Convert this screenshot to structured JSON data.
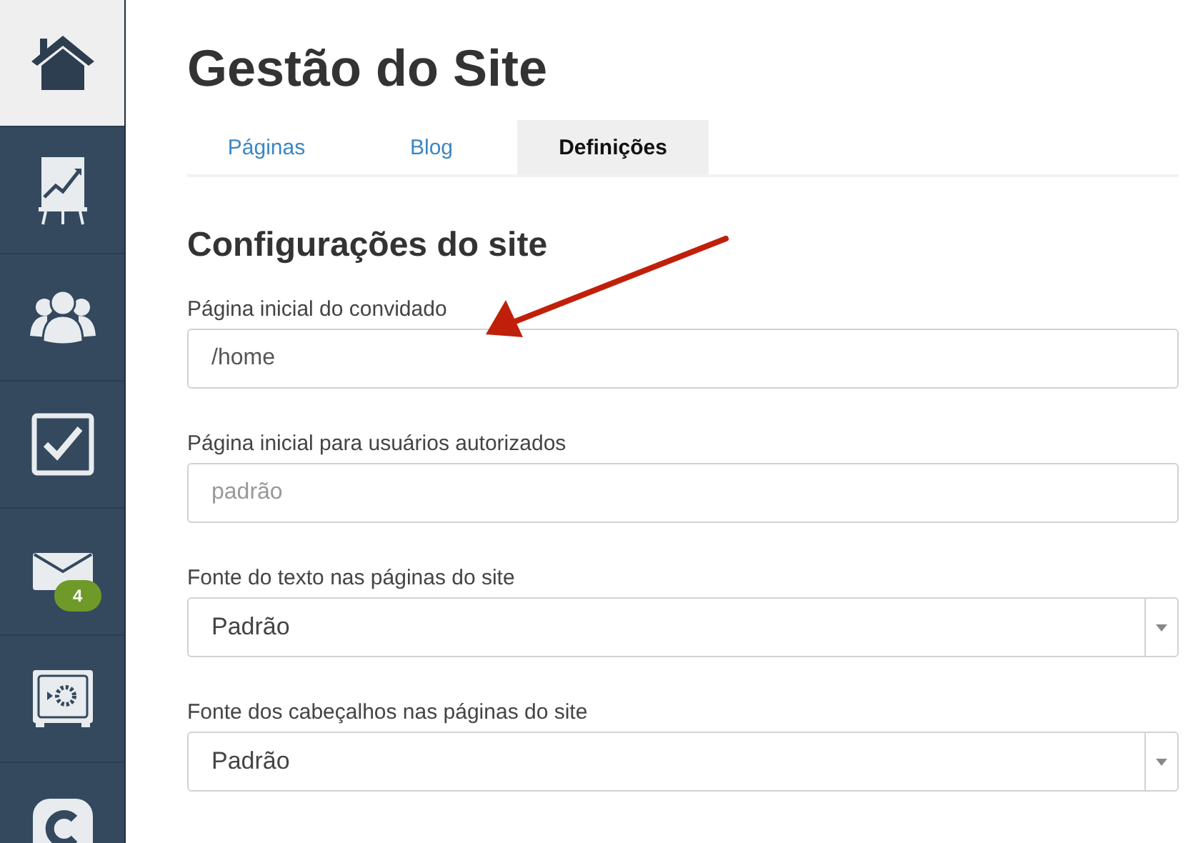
{
  "sidebar": {
    "items": [
      {
        "selected": true
      },
      {
        "selected": false
      },
      {
        "selected": false
      },
      {
        "selected": false
      },
      {
        "selected": false,
        "badge": "4"
      },
      {
        "selected": false
      },
      {
        "selected": false
      }
    ]
  },
  "title": "Gestão do Site",
  "tabs": [
    {
      "label": "Páginas",
      "selected": false
    },
    {
      "label": "Blog",
      "selected": false
    },
    {
      "label": "Definições",
      "selected": true
    }
  ],
  "section_title": "Configurações do site",
  "fields": [
    {
      "kind": "text",
      "label": "Página inicial do convidado",
      "value": "/home"
    },
    {
      "kind": "text",
      "label": "Página inicial para usuários autorizados",
      "placeholder": "padrão"
    },
    {
      "kind": "select",
      "label": "Fonte do texto nas páginas do site",
      "value": "Padrão"
    },
    {
      "kind": "select",
      "label": "Fonte dos cabeçalhos nas páginas do site",
      "value": "Padrão"
    }
  ],
  "annotations": [
    {
      "kind": "arrow"
    }
  ]
}
